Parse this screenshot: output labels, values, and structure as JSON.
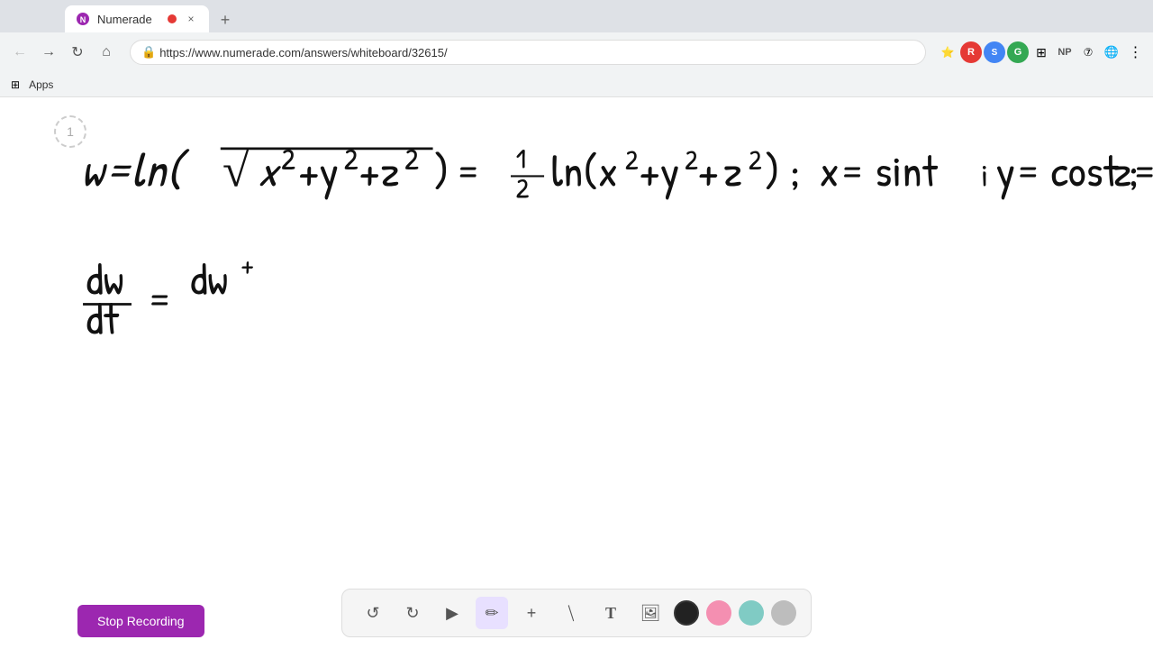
{
  "browser": {
    "tab": {
      "favicon": "N",
      "title": "Numerade",
      "close_label": "×"
    },
    "new_tab_label": "+",
    "nav": {
      "back_label": "←",
      "forward_label": "→",
      "refresh_label": "↻",
      "home_label": "⌂",
      "url": "https://www.numerade.com/answers/whiteboard/32615/",
      "lock_icon": "🔒"
    },
    "bookmarks": {
      "apps_label": "Apps"
    }
  },
  "page": {
    "page_number": "1"
  },
  "toolbar": {
    "undo_label": "↺",
    "redo_label": "↻",
    "select_label": "▲",
    "pen_label": "✏",
    "plus_label": "+",
    "eraser_label": "/",
    "text_label": "T",
    "image_label": "🖼",
    "colors": [
      "black",
      "pink",
      "green",
      "gray"
    ],
    "stop_recording_label": "Stop Recording"
  }
}
